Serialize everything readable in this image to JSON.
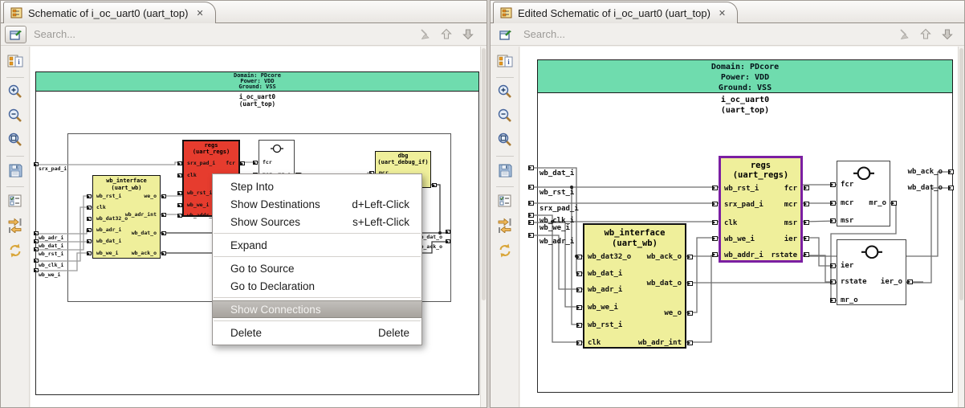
{
  "glyphs": {
    "close": "✕"
  },
  "search": {
    "placeholder": "Search..."
  },
  "banner": {
    "domain": "Domain: PDcore",
    "power": "Power: VDD",
    "ground": "Ground: VSS",
    "instance": "i_oc_uart0",
    "module": "(uart_top)"
  },
  "left": {
    "tab_title": "Schematic of i_oc_uart0 (uart_top)",
    "ports_in": [
      "srx_pad_i",
      "wb_adr_i",
      "wb_dat_i",
      "wb_rst_i",
      "wb_clk_i",
      "wb_we_i"
    ],
    "ports_out": [
      "wb_dat_o",
      "wb_ack_o"
    ],
    "regs": {
      "name": "regs",
      "type": "(uart_regs)",
      "left": [
        "srx_pad_i",
        "clk",
        "wb_rst_i",
        "wb_we_i",
        "wb_addr_i"
      ],
      "right": [
        "fcr",
        "mcr"
      ]
    },
    "mr": {
      "left": [
        "fcr",
        "mcr"
      ],
      "right": [
        "mr_o"
      ]
    },
    "dbg": {
      "name": "dbg",
      "type": "(uart_debug_if)",
      "left": [
        "mcr"
      ]
    },
    "wb": {
      "name": "wb_interface",
      "type": "(uart_wb)",
      "left": [
        "wb_rst_i",
        "clk",
        "wb_dat32_o",
        "wb_adr_i",
        "wb_dat_i",
        "wb_we_i"
      ],
      "right": [
        "we_o",
        "wb_adr_int",
        "wb_dat_o",
        "wb_ack_o"
      ]
    }
  },
  "right": {
    "tab_title": "Edited Schematic of i_oc_uart0 (uart_top)",
    "ports_in": [
      "wb_dat_i",
      "wb_rst_i",
      "srx_pad_i",
      "wb_clk_i",
      "wb_we_i",
      "wb_adr_i"
    ],
    "ports_out": [
      "wb_ack_o",
      "wb_dat_o"
    ],
    "regs": {
      "name": "regs",
      "type": "(uart_regs)",
      "left": [
        "wb_rst_i",
        "srx_pad_i",
        "clk",
        "wb_we_i",
        "wb_addr_i"
      ],
      "right": [
        "fcr",
        "mcr",
        "msr",
        "ier",
        "rstate"
      ]
    },
    "wb": {
      "name": "wb_interface",
      "type": "(uart_wb)",
      "left": [
        "wb_dat32_o",
        "wb_dat_i",
        "wb_adr_i",
        "wb_we_i",
        "wb_rst_i",
        "clk"
      ],
      "right": [
        "wb_ack_o",
        "wb_dat_o",
        "we_o",
        "wb_adr_int"
      ]
    },
    "mr": {
      "left": [
        "fcr",
        "mcr",
        "msr"
      ],
      "right": [
        "mr_o"
      ]
    },
    "ier": {
      "left": [
        "ier",
        "rstate",
        "mr_o"
      ],
      "right": [
        "ier_o"
      ]
    }
  },
  "menu": {
    "items": [
      {
        "label": "Step Into",
        "accel": ""
      },
      {
        "label": "Show Destinations",
        "accel": "d+Left-Click"
      },
      {
        "label": "Show Sources",
        "accel": "s+Left-Click"
      },
      {
        "label": "Expand",
        "accel": ""
      },
      {
        "label": "Go to Source",
        "accel": ""
      },
      {
        "label": "Go to Declaration",
        "accel": ""
      },
      {
        "label": "Show Connections",
        "accel": ""
      },
      {
        "label": "Delete",
        "accel": "Delete"
      }
    ]
  },
  "colors": {
    "banner_green": "#6fdcae",
    "block_red": "#e63c2e",
    "block_yellow": "#efef9b",
    "selected_purple": "#7b1fa2"
  }
}
